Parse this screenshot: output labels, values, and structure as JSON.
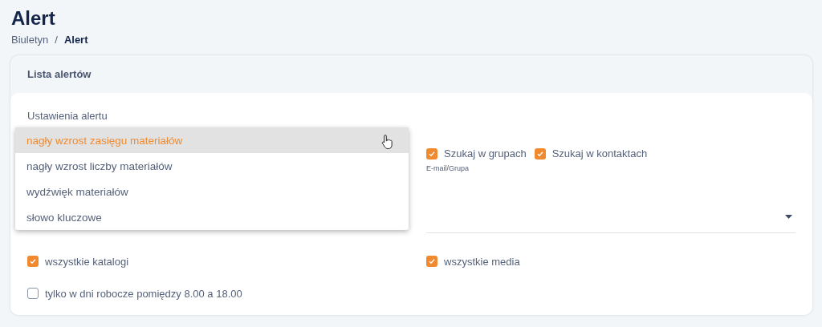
{
  "page": {
    "title": "Alert"
  },
  "breadcrumb": {
    "separator": "/",
    "items": [
      {
        "label": "Biuletyn",
        "current": false
      },
      {
        "label": "Alert",
        "current": true
      }
    ]
  },
  "card": {
    "title": "Lista alertów",
    "section_title": "Ustawienia alertu"
  },
  "alert_type_menu": {
    "options": [
      {
        "label": "nagły wzrost zasięgu materiałów",
        "selected": true
      },
      {
        "label": "nagły wzrost liczby materiałów",
        "selected": false
      },
      {
        "label": "wydźwięk materiałów",
        "selected": false
      },
      {
        "label": "słowo kluczowe",
        "selected": false
      }
    ]
  },
  "search_options": [
    {
      "label": "Szukaj w grupach",
      "checked": true
    },
    {
      "label": "Szukaj w kontaktach",
      "checked": true
    }
  ],
  "recipient_field": {
    "label": "E-mail/Grupa"
  },
  "filters": [
    {
      "label": "wszystkie katalogi",
      "checked": true
    },
    {
      "label": "wszystkie media",
      "checked": true
    },
    {
      "label": "tylko w dni robocze pomiędzy 8.00 a 18.00",
      "checked": false
    }
  ]
}
